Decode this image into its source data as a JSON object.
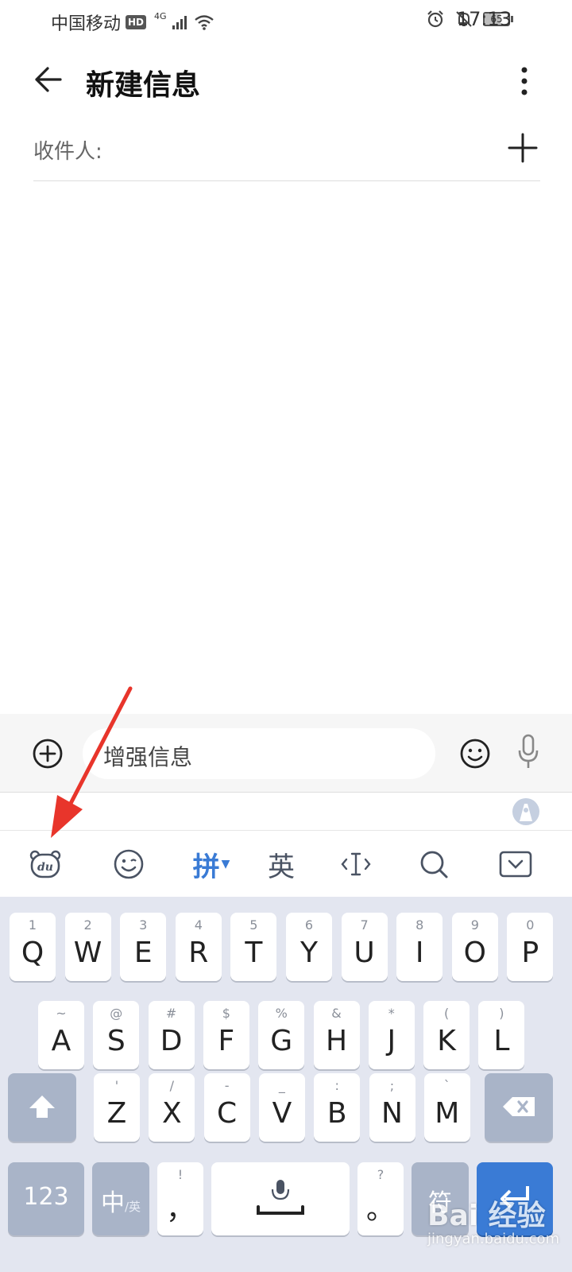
{
  "status_bar": {
    "carrier": "中国移动",
    "hd": "HD",
    "network": "4G",
    "battery": "65",
    "battery_level": 0.65,
    "time": "17:13",
    "icons": [
      "signal-icon",
      "wifi-icon",
      "alarm-icon",
      "bell-off-icon",
      "battery-icon"
    ]
  },
  "title_bar": {
    "title": "新建信息",
    "back_icon": "arrow-left-icon",
    "more_icon": "more-vertical-icon"
  },
  "recipient": {
    "label": "收件人:",
    "add_icon": "plus-icon"
  },
  "compose": {
    "placeholder": "增强信息",
    "attach_icon": "plus-circle-icon",
    "emoji_icon": "smiley-icon",
    "mic_icon": "microphone-icon"
  },
  "keyboard": {
    "toolbar": {
      "brand_icon": "du-bear-icon",
      "emoji_icon": "wink-icon",
      "pinyin": "拼",
      "english": "英",
      "cursor_icon": "text-cursor-icon",
      "search_icon": "search-icon",
      "hide_icon": "keyboard-hide-icon"
    },
    "accent_color": "#3a7bd5",
    "rows": [
      [
        {
          "hint": "1",
          "key": "Q"
        },
        {
          "hint": "2",
          "key": "W"
        },
        {
          "hint": "3",
          "key": "E"
        },
        {
          "hint": "4",
          "key": "R"
        },
        {
          "hint": "5",
          "key": "T"
        },
        {
          "hint": "6",
          "key": "Y"
        },
        {
          "hint": "7",
          "key": "U"
        },
        {
          "hint": "8",
          "key": "I"
        },
        {
          "hint": "9",
          "key": "O"
        },
        {
          "hint": "0",
          "key": "P"
        }
      ],
      [
        {
          "hint": "~",
          "key": "A"
        },
        {
          "hint": "@",
          "key": "S"
        },
        {
          "hint": "#",
          "key": "D"
        },
        {
          "hint": "$",
          "key": "F"
        },
        {
          "hint": "%",
          "key": "G"
        },
        {
          "hint": "&",
          "key": "H"
        },
        {
          "hint": "*",
          "key": "J"
        },
        {
          "hint": "(",
          "key": "K"
        },
        {
          "hint": ")",
          "key": "L"
        }
      ],
      [
        {
          "hint": "'",
          "key": "Z"
        },
        {
          "hint": "/",
          "key": "X"
        },
        {
          "hint": "-",
          "key": "C"
        },
        {
          "hint": "_",
          "key": "V"
        },
        {
          "hint": ":",
          "key": "B"
        },
        {
          "hint": ";",
          "key": "N"
        },
        {
          "hint": "`",
          "key": "M"
        }
      ]
    ],
    "bottom": {
      "num": "123",
      "lang_main": "中",
      "lang_sub": "/英",
      "comma_hint": "!",
      "comma": "，",
      "period_hint": "?",
      "period": "。",
      "symbol": "符"
    },
    "shift_icon": "shift-icon",
    "delete_icon": "backspace-icon",
    "space_icon": "space-mic-icon",
    "enter_icon": "enter-icon"
  },
  "watermark": {
    "logo": "Bai 经验",
    "site": "jingyan.baidu.com"
  }
}
